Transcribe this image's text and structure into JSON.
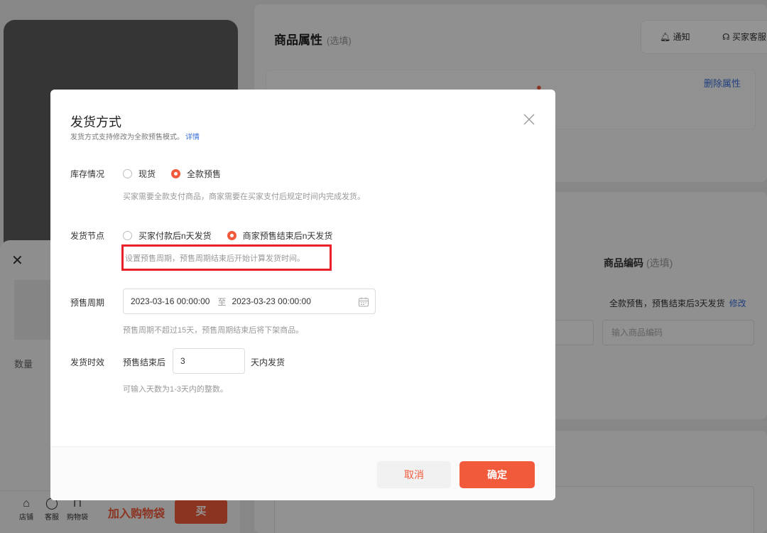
{
  "background": {
    "sheet": {
      "quantity_label": "数量"
    },
    "bottom_bar": {
      "items": [
        {
          "label": "店铺",
          "icon": "home-icon"
        },
        {
          "label": "客服",
          "icon": "chat-icon"
        },
        {
          "label": "购物袋",
          "icon": "bag-icon"
        }
      ],
      "add_to_cart": "加入购物袋",
      "buy": "买"
    },
    "attributes_panel": {
      "title": "商品属性",
      "optional": "(选填)",
      "delete_label": "删除属性"
    },
    "top_actions": {
      "notify": "通知",
      "buyer_service": "买家客服"
    },
    "sku_panel": {
      "code_title": "商品编码",
      "code_optional": "(选填)",
      "presale_note": "全款预售，预售结束后3天发货",
      "modify": "修改",
      "code_placeholder": "输入商品编码"
    }
  },
  "modal": {
    "title": "发货方式",
    "subtitle": "发货方式支持修改为全款预售模式。",
    "detail_link": "详情",
    "stock": {
      "label": "库存情况",
      "options": [
        {
          "label": "现货",
          "checked": false
        },
        {
          "label": "全款预售",
          "checked": true
        }
      ],
      "hint": "买家需要全款支付商品，商家需要在买家支付后规定时间内完成发货。"
    },
    "ship_node": {
      "label": "发货节点",
      "options": [
        {
          "label": "买家付款后n天发货",
          "checked": false
        },
        {
          "label": "商家预售结束后n天发货",
          "checked": true
        }
      ],
      "hint": "设置预售周期，预售周期结束后开始计算发货时间。"
    },
    "presale_period": {
      "label": "预售周期",
      "start": "2023-03-16 00:00:00",
      "separator": "至",
      "end": "2023-03-23 00:00:00",
      "hint": "预售周期不超过15天，预售周期结束后将下架商品。"
    },
    "ship_time": {
      "label": "发货时效",
      "prefix": "预售结束后",
      "value": "3",
      "suffix": "天内发货",
      "hint": "可输入天数为1-3天内的整数。"
    },
    "footer": {
      "cancel": "取消",
      "confirm": "确定"
    },
    "colors": {
      "accent": "#f25a3c",
      "link": "#3a6fd8",
      "highlight": "#e8202a"
    }
  }
}
